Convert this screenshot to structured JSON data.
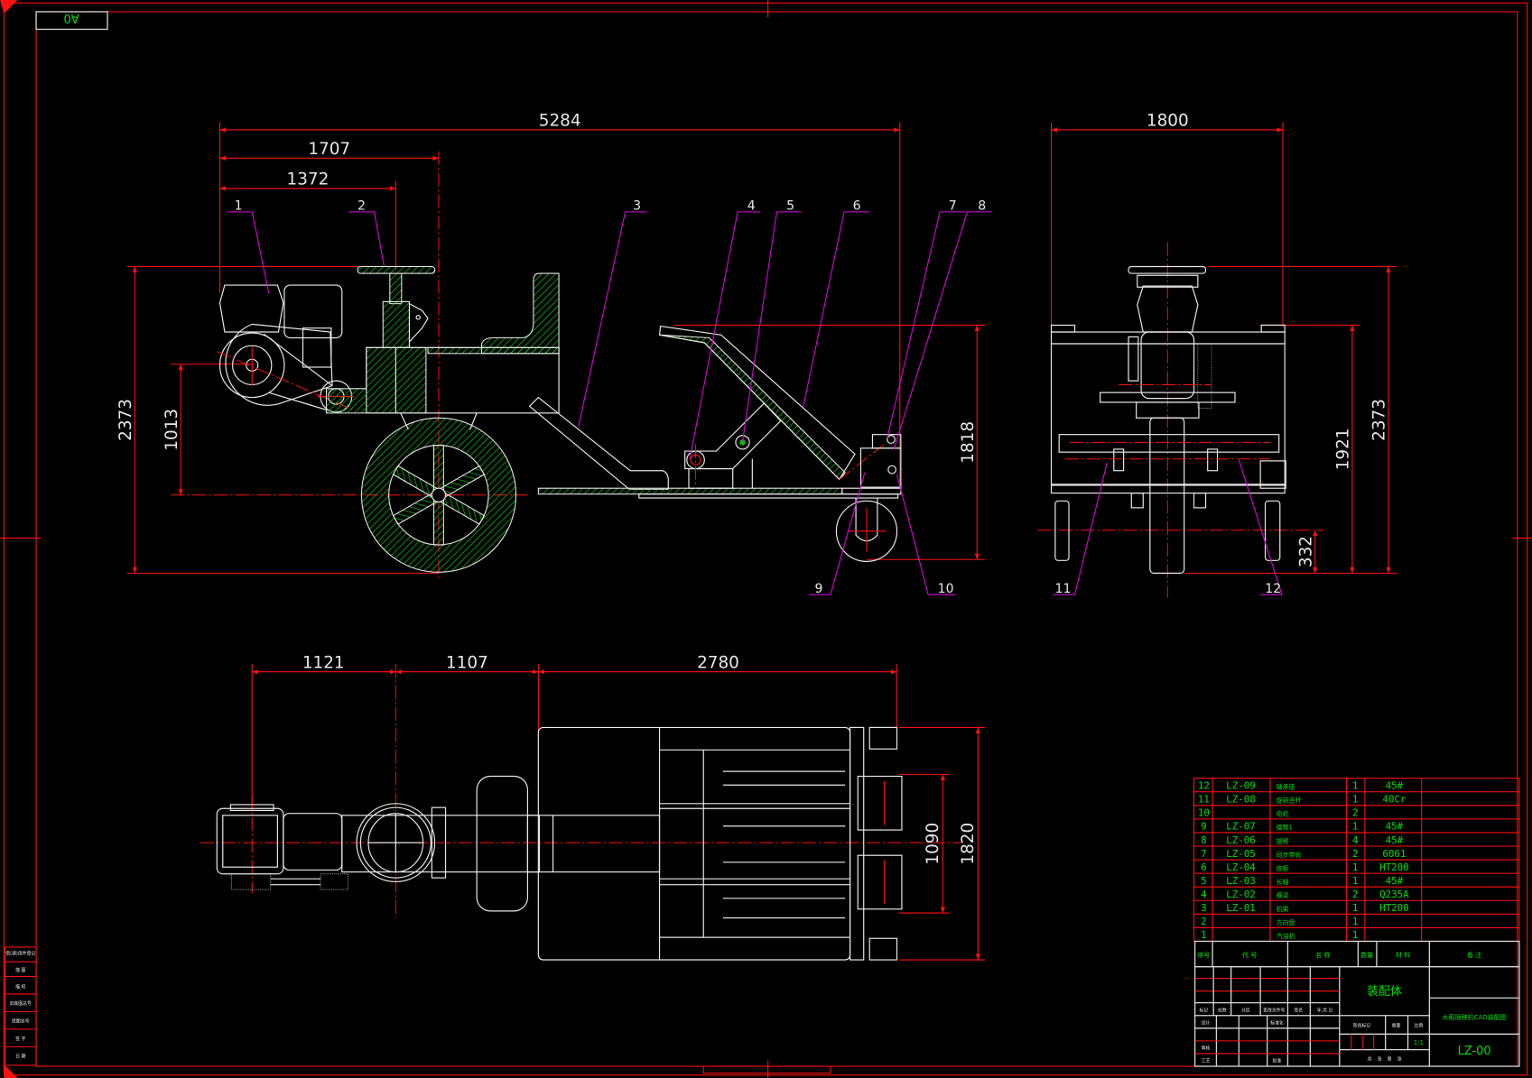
{
  "sheet": {
    "size_label": "A0"
  },
  "colors": {
    "background": "#000000",
    "frame": "#ff1010",
    "geometry": "#e8e8e8",
    "hatch": "#00c000",
    "leader": "#e000e0",
    "text": "#00e000"
  },
  "left_strip": [
    "借(通)用件登记",
    "描 图",
    "描 校",
    "旧底图总号",
    "底图总号",
    "签 字",
    "日 期"
  ],
  "side_view": {
    "dimensions": {
      "overall_length": "5284",
      "to_wheel": "1707",
      "to_steering": "1372",
      "overall_height": "2373",
      "axle_height": "1013",
      "rear_height": "1818"
    },
    "balloons": [
      "1",
      "2",
      "3",
      "4",
      "5",
      "6",
      "7",
      "8",
      "9",
      "10"
    ]
  },
  "front_view": {
    "dimensions": {
      "width": "1800",
      "frame_height": "1921",
      "overall_height": "2373",
      "caster_axle": "332"
    },
    "balloons": [
      "11",
      "12"
    ]
  },
  "top_view": {
    "dimensions": {
      "engine_to_steering": "1121",
      "steering_to_frame": "1107",
      "frame_length": "2780",
      "module_span": "1090",
      "overall_width": "1820"
    }
  },
  "parts_list": {
    "rows": [
      {
        "no": "12",
        "code": "LZ-09",
        "name": "轴承座",
        "qty": "1",
        "material": "45#"
      },
      {
        "no": "11",
        "code": "LZ-08",
        "name": "旋转连杆",
        "qty": "1",
        "material": "40Cr"
      },
      {
        "no": "10",
        "code": "",
        "name": "电机",
        "qty": "2",
        "material": ""
      },
      {
        "no": "9",
        "code": "LZ-07",
        "name": "摆臂1",
        "qty": "1",
        "material": "45#"
      },
      {
        "no": "8",
        "code": "LZ-06",
        "name": "摆臂",
        "qty": "4",
        "material": "45#"
      },
      {
        "no": "7",
        "code": "LZ-05",
        "name": "同步带轮",
        "qty": "2",
        "material": "6061"
      },
      {
        "no": "6",
        "code": "LZ-04",
        "name": "底板",
        "qty": "1",
        "material": "HT200"
      },
      {
        "no": "5",
        "code": "LZ-03",
        "name": "长轴",
        "qty": "1",
        "material": "45#"
      },
      {
        "no": "4",
        "code": "LZ-02",
        "name": "横梁",
        "qty": "2",
        "material": "Q235A"
      },
      {
        "no": "3",
        "code": "LZ-01",
        "name": "机架",
        "qty": "1",
        "material": "HT200"
      },
      {
        "no": "2",
        "code": "",
        "name": "方向盘",
        "qty": "1",
        "material": ""
      },
      {
        "no": "1",
        "code": "",
        "name": "汽油机",
        "qty": "1",
        "material": ""
      }
    ],
    "headers": {
      "no": "序号",
      "code": "代 号",
      "name": "名 称",
      "qty": "数量",
      "material": "材 料",
      "remark": "备 注"
    }
  },
  "title_block": {
    "revision_headers": [
      "标记",
      "处数",
      "分区",
      "更改文件号",
      "签名",
      "年.月.日"
    ],
    "design": "设计",
    "standardization": "标准化",
    "review": "审核",
    "process": "工艺",
    "approve": "批准",
    "assembly_name": "装配体",
    "stage_mark": "阶段标记",
    "weight": "重量",
    "scale_label": "比例",
    "scale": "1:1",
    "sheets": "共    张    第    张",
    "drawing_title": "水稻插秧机CAD装配图",
    "drawing_number": "LZ-00"
  }
}
